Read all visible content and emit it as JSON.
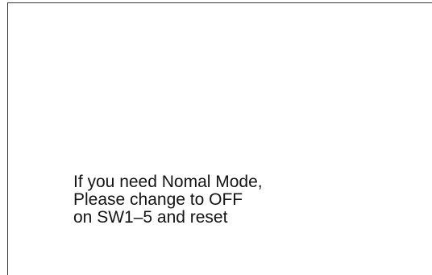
{
  "screen": {
    "message_lines": [
      "If you need Nomal Mode,",
      "Please change to OFF",
      "on SW1–5 and reset"
    ]
  },
  "colors": {
    "background": "#ffffff",
    "text": "#141414",
    "border": "#3a3a3a"
  }
}
